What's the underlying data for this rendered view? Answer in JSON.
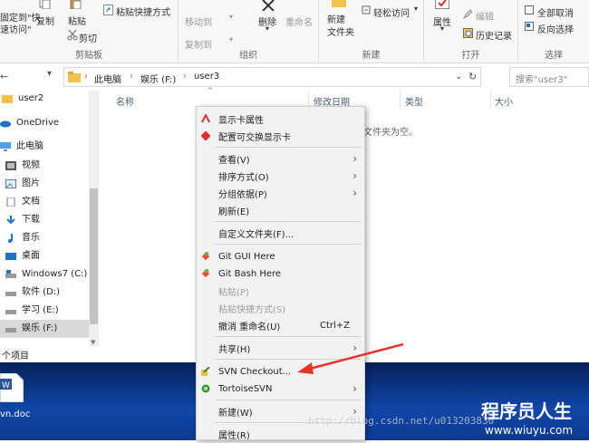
{
  "ribbon": {
    "clipboard": {
      "pin_label": "固定到\"快\n速访问\"",
      "copy_label": "复制",
      "paste_label": "粘贴",
      "paste_shortcut_label": "粘贴快捷方式",
      "cut_label": "剪切",
      "group_label": "剪贴板"
    },
    "organize": {
      "move_to_label": "移动到",
      "copy_to_label": "复制到",
      "delete_label": "删除",
      "rename_label": "重命名",
      "group_label": "组织"
    },
    "new": {
      "new_folder_label": "新建\n文件夹",
      "easy_access_label": "轻松访问",
      "group_label": "新建"
    },
    "open": {
      "properties_label": "属性",
      "edit_label": "编辑",
      "history_label": "历史记录",
      "group_label": "打开"
    },
    "select": {
      "select_all_label": "全部取消",
      "invert_label": "反向选择",
      "group_label": "选择"
    }
  },
  "address": {
    "crumbs": [
      "此电脑",
      "娱乐 (F:)",
      "user3"
    ],
    "search_placeholder": "搜索\"user3\""
  },
  "nav": {
    "items": [
      {
        "label": "user2",
        "icon": "folder-icon"
      },
      {
        "label": "OneDrive",
        "icon": "cloud-icon"
      },
      {
        "label": "此电脑",
        "icon": "computer-icon"
      },
      {
        "label": "视频",
        "icon": "video-icon"
      },
      {
        "label": "图片",
        "icon": "picture-icon"
      },
      {
        "label": "文档",
        "icon": "document-icon"
      },
      {
        "label": "下载",
        "icon": "download-icon"
      },
      {
        "label": "音乐",
        "icon": "music-icon"
      },
      {
        "label": "桌面",
        "icon": "desktop-icon"
      },
      {
        "label": "Windows7 (C:)",
        "icon": "drive-icon"
      },
      {
        "label": "软件 (D:)",
        "icon": "drive-icon"
      },
      {
        "label": "学习 (E:)",
        "icon": "drive-icon"
      },
      {
        "label": "娱乐 (F:)",
        "icon": "drive-icon"
      }
    ],
    "status": "个项目"
  },
  "content": {
    "columns": [
      "名称",
      "修改日期",
      "类型",
      "大小"
    ],
    "empty_text": "文件夹为空。"
  },
  "desktop": {
    "file_label": "vn.doc"
  },
  "context_menu": {
    "items": [
      {
        "label": "显示卡属性",
        "icon": "display-card-icon"
      },
      {
        "label": "配置可交换显示卡",
        "icon": "switchable-graphics-icon"
      },
      {
        "label": "查看(V)"
      },
      {
        "label": "排序方式(O)"
      },
      {
        "label": "分组依据(P)"
      },
      {
        "label": "刷新(E)"
      },
      {
        "label": "自定义文件夹(F)..."
      },
      {
        "label": "Git GUI Here",
        "icon": "git-icon"
      },
      {
        "label": "Git Bash Here",
        "icon": "git-icon"
      },
      {
        "label": "粘贴(P)"
      },
      {
        "label": "粘贴快捷方式(S)"
      },
      {
        "label": "撤消 重命名(U)",
        "shortcut": "Ctrl+Z"
      },
      {
        "label": "共享(H)"
      },
      {
        "label": "SVN Checkout...",
        "icon": "svn-checkout-icon"
      },
      {
        "label": "TortoiseSVN",
        "icon": "tortoisesvn-icon"
      },
      {
        "label": "新建(W)"
      },
      {
        "label": "属性(R)"
      }
    ]
  },
  "watermark": {
    "url": "http://blog.csdn.net/u013203830",
    "site_title": "程序员人生",
    "site_url": "www.wiuyu.com"
  },
  "colors": {
    "arrow": "#e8322c",
    "taskbar": "#0d3a93",
    "menu_bg": "#f2f2f2"
  }
}
